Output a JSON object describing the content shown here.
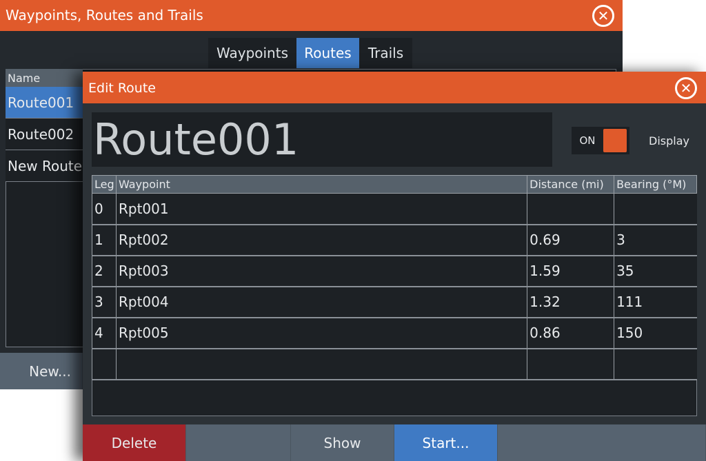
{
  "back_dialog": {
    "title": "Waypoints, Routes and Trails",
    "tabs": [
      {
        "label": "Waypoints"
      },
      {
        "label": "Routes",
        "active": true
      },
      {
        "label": "Trails"
      }
    ],
    "list_header": "Name",
    "items": [
      {
        "label": "Route001",
        "selected": true
      },
      {
        "label": "Route002"
      },
      {
        "label": "New Route..."
      }
    ],
    "new_button": "New..."
  },
  "edit_route": {
    "title": "Edit Route",
    "name": "Route001",
    "toggle_label": "ON",
    "toggle_on": true,
    "display_label": "Display",
    "columns": [
      "Leg",
      "Waypoint",
      "Distance (mi)",
      "Bearing (°M)"
    ],
    "rows": [
      [
        "0",
        "Rpt001",
        "",
        ""
      ],
      [
        "1",
        "Rpt002",
        "0.69",
        "3"
      ],
      [
        "2",
        "Rpt003",
        "1.59",
        "35"
      ],
      [
        "3",
        "Rpt004",
        "1.32",
        "111"
      ],
      [
        "4",
        "Rpt005",
        "0.86",
        "150"
      ]
    ],
    "buttons": {
      "delete": "Delete",
      "show": "Show",
      "start": "Start..."
    }
  },
  "colors": {
    "title_bar": "#e05a2b",
    "selected": "#3f7ac4",
    "delete": "#a3242a"
  }
}
